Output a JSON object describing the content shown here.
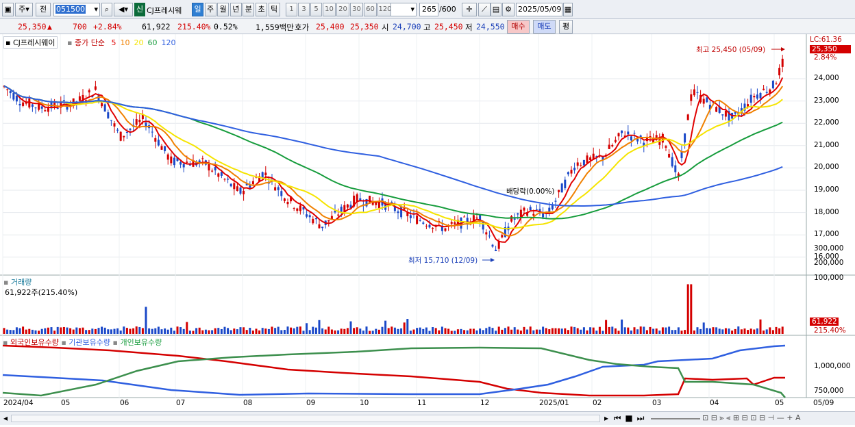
{
  "toolbar": {
    "mode_label": "주",
    "prev_label": "전",
    "code_value": "051500",
    "new_badge": "신",
    "stock_name": "CJ프레시웨",
    "periods": [
      "일",
      "주",
      "월",
      "년",
      "분",
      "초",
      "틱"
    ],
    "active_period": "일",
    "intervals": [
      "1",
      "3",
      "5",
      "10",
      "20",
      "30",
      "60",
      "120"
    ],
    "count_value": "265",
    "count_total": "/600",
    "date_value": "2025/05/09"
  },
  "quote": {
    "price": "25,350",
    "arrow": "▲",
    "change": "700",
    "change_pct": "+2.84%",
    "volume": "61,922",
    "volume_ratio": "215.40%",
    "turnover": "0.52%",
    "amount": "1,559백만",
    "ask_label": "호가",
    "ask": "25,400",
    "bid": "25,350",
    "open_label": "시",
    "open": "24,700",
    "high_label": "고",
    "high": "25,450",
    "low_label": "저",
    "low": "24,550",
    "buy_label": "매수",
    "sell_label": "매도",
    "eval_label": "평"
  },
  "price_panel": {
    "legend_name": "CJ프레시웨이",
    "legend_ma": "종가 단순",
    "ma_periods": [
      "5",
      "10",
      "20",
      "60",
      "120"
    ],
    "ma_colors": [
      "#e00000",
      "#f08000",
      "#f5e400",
      "#169c3c",
      "#2f5fe0"
    ],
    "lc_label": "LC:61.36",
    "current_price_tag": "25,350",
    "current_pct_tag": "2.84%",
    "high_annotation": "최고 25,450 (05/09)",
    "low_annotation": "최저 15,710 (12/09)",
    "dividend_annotation": "배당락(0.00%)",
    "y_ticks": [
      "24,000",
      "23,000",
      "22,000",
      "21,000",
      "20,000",
      "19,000",
      "18,000",
      "17,000",
      "16,000"
    ]
  },
  "volume_panel": {
    "title": "거래량",
    "value_label": "61,922주(215.40%)",
    "y_ticks": [
      "300,000",
      "200,000",
      "100,000"
    ],
    "current_tag": "61,922",
    "current_pct_tag": "215.40%"
  },
  "holder_panel": {
    "series_names": [
      "외국인보유수량",
      "기관보유수량",
      "개인보유수량"
    ],
    "series_colors": [
      "#e00000",
      "#2f5fe0",
      "#169c3c"
    ],
    "y_ticks": [
      "1,000,000",
      "750,000"
    ]
  },
  "x_axis": {
    "labels": [
      "2024/04",
      "05",
      "06",
      "07",
      "08",
      "09",
      "10",
      "11",
      "12",
      "2025/01",
      "02",
      "03",
      "04",
      "05",
      "05/09"
    ]
  }
}
